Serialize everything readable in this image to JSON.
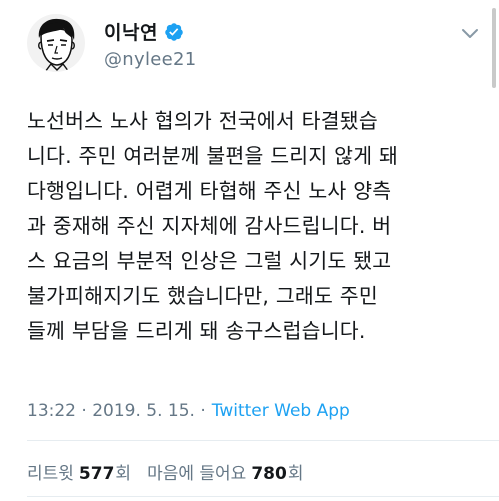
{
  "profile": {
    "display_name": "이낙연",
    "handle": "@nylee21",
    "verified": true,
    "avatar_icon": "caricature-avatar-icon",
    "menu_icon": "chevron-down-icon"
  },
  "tweet": {
    "lines": [
      "노선버스 노사 협의가 전국에서 타결됐습",
      "니다. 주민 여러분께 불편을 드리지 않게 돼",
      "다행입니다. 어렵게 타협해 주신 노사 양측",
      "과 중재해 주신 지자체에 감사드립니다. 버",
      "스 요금의 부분적 인상은 그럴 시기도 됐고",
      "불가피해지기도 했습니다만, 그래도 주민",
      "들께 부담을 드리게 돼 송구스럽습니다."
    ]
  },
  "meta": {
    "time_date": "13:22 · 2019. 5. 15. ·",
    "source": "Twitter Web App"
  },
  "stats": {
    "retweets_label": "리트윗",
    "retweets_count": "577",
    "retweets_unit": "회",
    "likes_label": "마음에 들어요",
    "likes_count": "780",
    "likes_unit": "회"
  },
  "colors": {
    "link": "#1da1f2",
    "muted": "#657786",
    "verified_badge": "#1da1f2"
  }
}
